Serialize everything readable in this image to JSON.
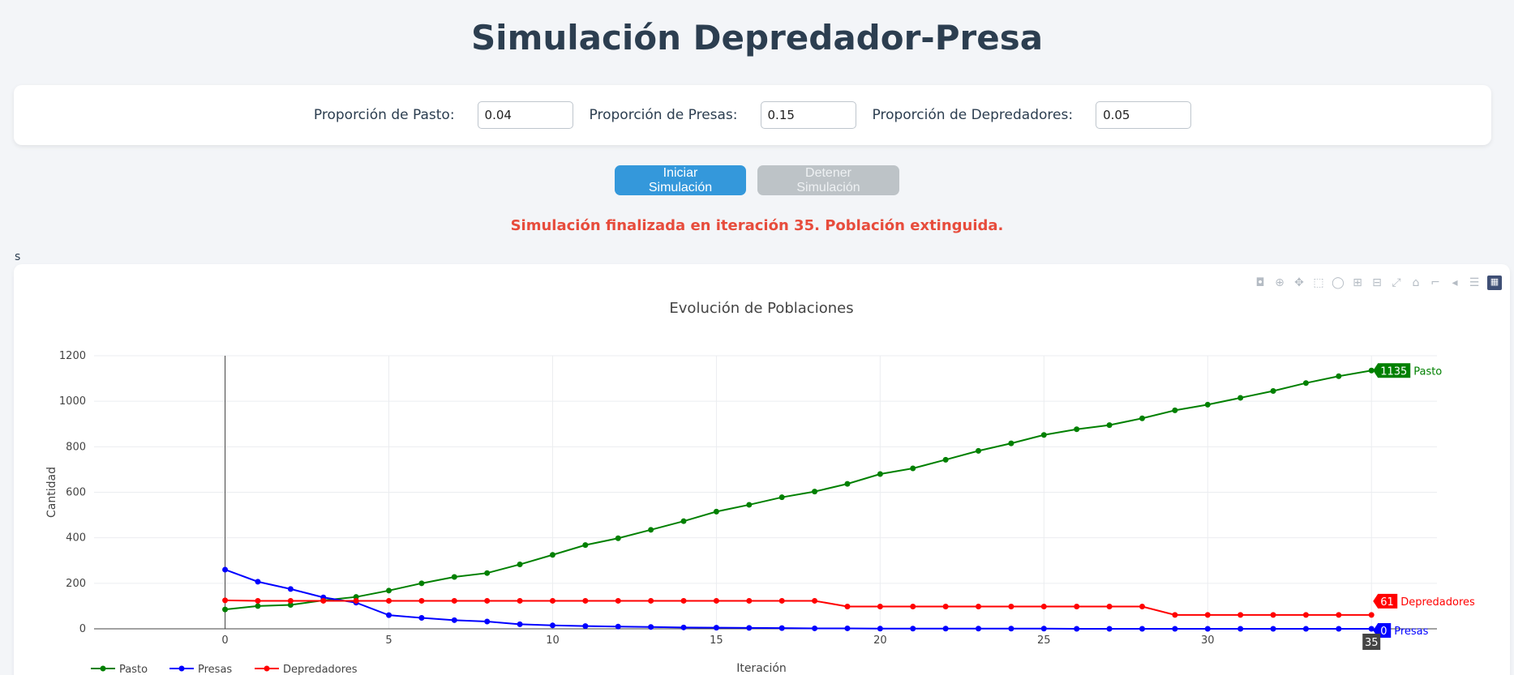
{
  "header": {
    "title": "Simulación Depredador-Presa"
  },
  "controls": {
    "pasto_label": "Proporción de Pasto:",
    "pasto_value": "0.04",
    "presas_label": "Proporción de Presas:",
    "presas_value": "0.15",
    "depredadores_label": "Proporción de Depredadores:",
    "depredadores_value": "0.05"
  },
  "buttons": {
    "start": "Iniciar Simulación",
    "stop": "Detener Simulación"
  },
  "status": "Simulación finalizada en iteración 35. Población extinguida.",
  "stray_text": "s",
  "modebar": [
    "camera-icon",
    "zoom-icon",
    "pan-icon",
    "box-select-icon",
    "lasso-icon",
    "zoom-in-icon",
    "zoom-out-icon",
    "autoscale-icon",
    "reset-axes-icon",
    "spike-lines-icon",
    "hover-closest-icon",
    "hover-compare-icon",
    "plotly-logo-icon"
  ],
  "chart_data": {
    "type": "line",
    "title": "Evolución de Poblaciones",
    "xlabel": "Iteración",
    "ylabel": "Cantidad",
    "xlim": [
      -4,
      37
    ],
    "ylim": [
      0,
      1200
    ],
    "xticks": [
      0,
      5,
      10,
      15,
      20,
      25,
      30,
      35
    ],
    "yticks": [
      0,
      200,
      400,
      600,
      800,
      1000,
      1200
    ],
    "grid": true,
    "legend": "bottom-left",
    "hover_x_label": "35",
    "series": [
      {
        "name": "Pasto",
        "color": "#008000",
        "end_label": "1135",
        "values": [
          85,
          100,
          105,
          125,
          140,
          168,
          200,
          228,
          245,
          283,
          325,
          368,
          398,
          435,
          473,
          515,
          545,
          578,
          603,
          637,
          680,
          705,
          743,
          782,
          815,
          852,
          877,
          895,
          925,
          960,
          985,
          1015,
          1045,
          1080,
          1110,
          1135
        ]
      },
      {
        "name": "Presas",
        "color": "#0000ff",
        "end_label": "0",
        "values": [
          260,
          207,
          175,
          138,
          115,
          60,
          48,
          38,
          32,
          20,
          15,
          12,
          10,
          8,
          6,
          5,
          4,
          3,
          2,
          2,
          1,
          1,
          1,
          1,
          1,
          1,
          0,
          0,
          0,
          0,
          0,
          0,
          0,
          0,
          0,
          0
        ]
      },
      {
        "name": "Depredadores",
        "color": "#ff0000",
        "end_label": "61",
        "values": [
          125,
          123,
          123,
          123,
          123,
          123,
          123,
          123,
          123,
          123,
          123,
          123,
          123,
          123,
          123,
          123,
          123,
          123,
          123,
          98,
          98,
          98,
          98,
          98,
          98,
          98,
          98,
          98,
          98,
          61,
          61,
          61,
          61,
          61,
          61,
          61
        ]
      }
    ]
  }
}
